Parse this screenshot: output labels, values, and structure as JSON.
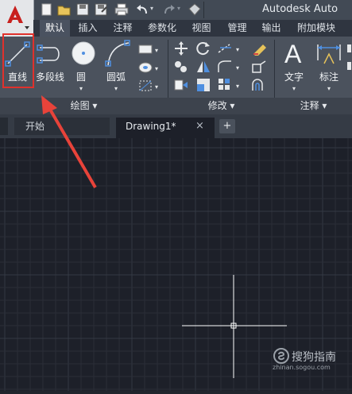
{
  "title_bar": {
    "title": "Autodesk Auto",
    "quick_access_icons": [
      "new-icon",
      "open-icon",
      "save-icon",
      "save-as-icon",
      "print-icon",
      "undo-icon",
      "undo-dropdown-icon",
      "redo-icon",
      "redo-dropdown-icon",
      "workspace-icon"
    ]
  },
  "ribbon_tabs": [
    "默认",
    "插入",
    "注释",
    "参数化",
    "视图",
    "管理",
    "输出",
    "附加模块"
  ],
  "draw_panel": {
    "title": "绘图 ▾",
    "tools": [
      {
        "label": "直线",
        "icon": "line-icon"
      },
      {
        "label": "多段线",
        "icon": "polyline-icon"
      },
      {
        "label": "圆",
        "icon": "circle-icon",
        "dropdown": "▾"
      },
      {
        "label": "圆弧",
        "icon": "arc-icon",
        "dropdown": "▾"
      }
    ],
    "small_tools": [
      "rectangle-icon",
      "hatch-icon",
      "gradient-icon"
    ]
  },
  "modify_panel": {
    "title": "修改 ▾",
    "tools": [
      "move-icon",
      "rotate-icon",
      "trim-icon",
      "erase-icon",
      "copy-icon",
      "mirror-icon",
      "fillet-icon",
      "explode-icon",
      "stretch-icon",
      "scale-icon",
      "array-icon",
      "offset-icon"
    ]
  },
  "annotation_panel": {
    "title": "注释 ▾",
    "tools": [
      {
        "label": "文字",
        "icon": "text-icon",
        "dropdown": "▾"
      },
      {
        "label": "标注",
        "icon": "dimension-icon",
        "dropdown": "▾"
      }
    ]
  },
  "doc_tabs": {
    "start": "开始",
    "drawing": "Drawing1*",
    "close": "×",
    "new": "+"
  },
  "watermark": {
    "brand": "搜狗指南",
    "url": "zhinan.sogou.com"
  },
  "colors": {
    "highlight": "#e0312c",
    "arrow": "#e8433a",
    "accent_icon": "#4f8fe0"
  }
}
